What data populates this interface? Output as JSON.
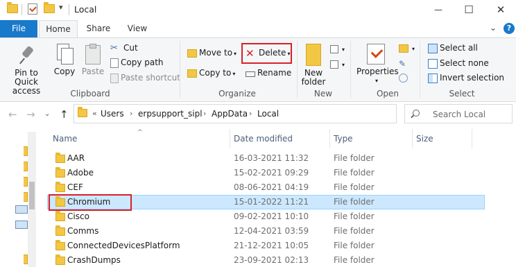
{
  "window": {
    "title": "Local",
    "minimize": "—",
    "maximize": "☐",
    "close": "✕"
  },
  "tabs": {
    "file": "File",
    "home": "Home",
    "share": "Share",
    "view": "View",
    "expand": "⌄"
  },
  "ribbon": {
    "clipboard": {
      "pin_label_1": "Pin to Quick",
      "pin_label_2": "access",
      "copy": "Copy",
      "paste": "Paste",
      "cut": "Cut",
      "copy_path": "Copy path",
      "paste_shortcut": "Paste shortcut",
      "group": "Clipboard"
    },
    "organize": {
      "move_to": "Move to",
      "copy_to": "Copy to",
      "delete": "Delete",
      "rename": "Rename",
      "group": "Organize"
    },
    "new": {
      "new_folder_1": "New",
      "new_folder_2": "folder",
      "group": "New"
    },
    "open": {
      "properties": "Properties",
      "group": "Open"
    },
    "select": {
      "select_all": "Select all",
      "select_none": "Select none",
      "invert_selection": "Invert selection",
      "group": "Select"
    }
  },
  "address": {
    "overflow": "«",
    "crumbs": [
      "Users",
      "erpsupport_sipl",
      "AppData",
      "Local"
    ],
    "separator": "›",
    "refresh": "↻",
    "dropdown": "⌄"
  },
  "search": {
    "placeholder": "Search Local"
  },
  "columns": {
    "name": "Name",
    "date": "Date modified",
    "type": "Type",
    "size": "Size"
  },
  "files": [
    {
      "name": "AAR",
      "date": "16-03-2021 11:32",
      "type": "File folder"
    },
    {
      "name": "Adobe",
      "date": "15-02-2021 09:29",
      "type": "File folder"
    },
    {
      "name": "CEF",
      "date": "08-06-2021 04:19",
      "type": "File folder"
    },
    {
      "name": "Chromium",
      "date": "15-01-2022 11:21",
      "type": "File folder"
    },
    {
      "name": "Cisco",
      "date": "09-02-2021 10:10",
      "type": "File folder"
    },
    {
      "name": "Comms",
      "date": "12-04-2021 03:59",
      "type": "File folder"
    },
    {
      "name": "ConnectedDevicesPlatform",
      "date": "21-12-2021 10:05",
      "type": "File folder"
    },
    {
      "name": "CrashDumps",
      "date": "23-09-2021 02:13",
      "type": "File folder"
    }
  ],
  "colors": {
    "accent": "#1979ca",
    "selection": "#cce8ff",
    "highlight_box": "#d6202a",
    "folder": "#f2c744"
  }
}
